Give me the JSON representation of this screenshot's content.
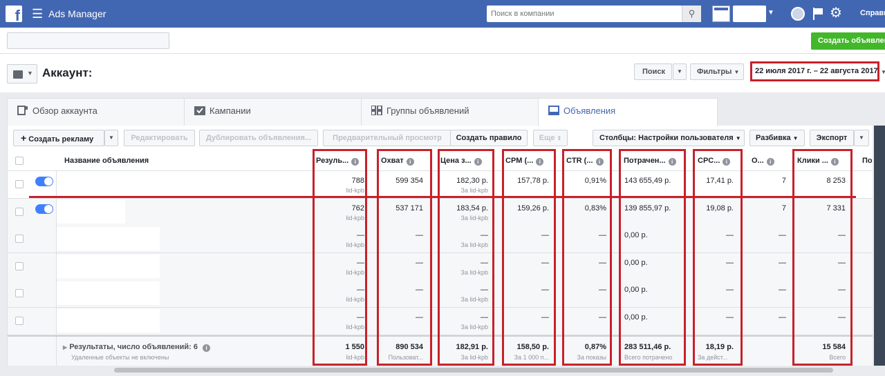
{
  "topbar": {
    "app_title": "Ads Manager",
    "search_placeholder": "Поиск в компании",
    "help": "Справк"
  },
  "header": {
    "create_button": "Создать объявлен",
    "account_title": "Аккаунт:",
    "search_button": "Поиск",
    "filters_button": "Фильтры",
    "date_range": "22 июля 2017 г. – 22 августа 2017 г."
  },
  "tabs": [
    {
      "label": "Обзор аккаунта"
    },
    {
      "label": "Кампании"
    },
    {
      "label": "Группы объявлений"
    },
    {
      "label": "Объявления"
    }
  ],
  "toolbar": {
    "create_ad": "Создать рекламу",
    "edit": "Редактировать",
    "duplicate": "Дублировать объявления...",
    "preview": "Предварительный просмотр",
    "create_rule": "Создать правило",
    "more": "Еще",
    "columns": "Столбцы: Настройки пользователя",
    "breakdown": "Разбивка",
    "export": "Экспорт"
  },
  "table": {
    "columns": {
      "name": "Название объявления",
      "results": "Резуль...",
      "reach": "Охват",
      "cost": "Цена з...",
      "cpm": "CPM (...",
      "ctr": "CTR (...",
      "spent": "Потрачен...",
      "cpc": "CPC...",
      "o": "О...",
      "clicks": "Клики ...",
      "extra": "По"
    },
    "rows": [
      {
        "results": "788",
        "results_sub": "lid-kpb",
        "reach": "599 354",
        "cost": "182,30 р.",
        "cost_sub": "За lid-kpb",
        "cpm": "157,78 р.",
        "ctr": "0,91%",
        "spent": "143 655,49 р.",
        "cpc": "17,41 р.",
        "o": "7",
        "clicks": "8 253"
      },
      {
        "results": "762",
        "results_sub": "lid-kpb",
        "reach": "537 171",
        "cost": "183,54 р.",
        "cost_sub": "За lid-kpb",
        "cpm": "159,26 р.",
        "ctr": "0,83%",
        "spent": "139 855,97 р.",
        "cpc": "19,08 р.",
        "o": "7",
        "clicks": "7 331"
      },
      {
        "results": "—",
        "results_sub": "lid-kpb",
        "reach": "—",
        "cost": "—",
        "cost_sub": "За lid-kpb",
        "cpm": "—",
        "ctr": "—",
        "spent": "0,00 р.",
        "cpc": "—",
        "o": "—",
        "clicks": "—"
      },
      {
        "results": "—",
        "results_sub": "lid-kpb",
        "reach": "—",
        "cost": "—",
        "cost_sub": "За lid-kpb",
        "cpm": "—",
        "ctr": "—",
        "spent": "0,00 р.",
        "cpc": "—",
        "o": "—",
        "clicks": "—"
      },
      {
        "results": "—",
        "results_sub": "lid-kpb",
        "reach": "—",
        "cost": "—",
        "cost_sub": "За lid-kpb",
        "cpm": "—",
        "ctr": "—",
        "spent": "0,00 р.",
        "cpc": "—",
        "o": "—",
        "clicks": "—"
      },
      {
        "results": "—",
        "results_sub": "lid-kpb",
        "reach": "—",
        "cost": "—",
        "cost_sub": "За lid-kpb",
        "cpm": "—",
        "ctr": "—",
        "spent": "0,00 р.",
        "cpc": "—",
        "o": "—",
        "clicks": "—"
      }
    ],
    "total": {
      "label": "Результаты, число объявлений: 6",
      "sub": "Удаленные объекты не включены",
      "results": "1 550",
      "results_sub": "lid-kpb",
      "reach": "890 534",
      "reach_sub": "Пользоват...",
      "cost": "182,91 р.",
      "cost_sub": "За lid-kpb",
      "cpm": "158,50 р.",
      "cpm_sub": "За 1 000 п...",
      "ctr": "0,87%",
      "ctr_sub": "За показы",
      "spent": "283 511,46 р.",
      "spent_sub": "Всего потрачено",
      "cpc": "18,19 р.",
      "cpc_sub": "За дейст...",
      "clicks": "15 584",
      "clicks_sub": "Всего"
    }
  },
  "colors": {
    "brand": "#4267b2",
    "green": "#42b72a",
    "annotation_red": "#c8202a",
    "toggle_on": "#4080ff"
  }
}
